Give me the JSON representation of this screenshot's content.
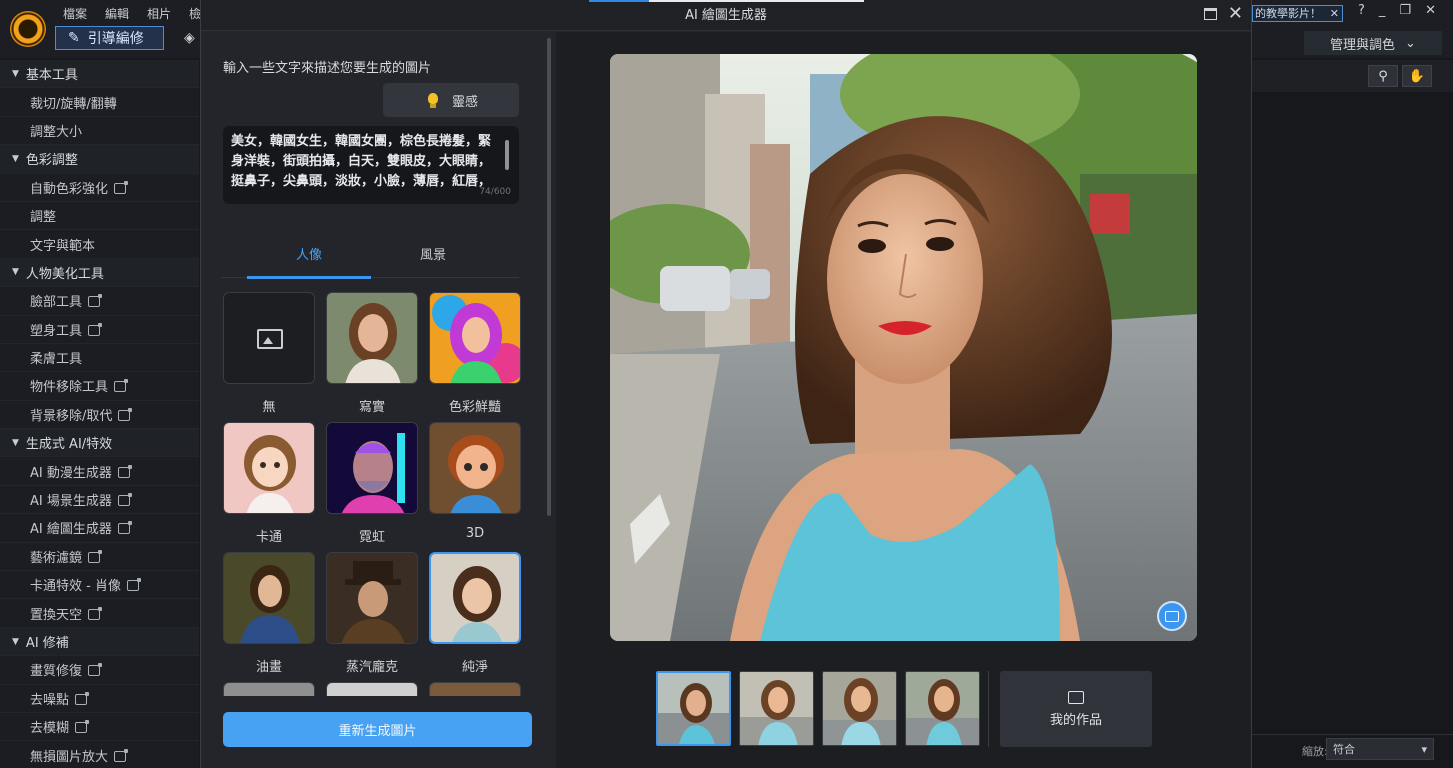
{
  "app": {
    "menu": [
      "檔案",
      "編輯",
      "相片",
      "檢"
    ],
    "guide_label": "引導編修",
    "notice": "的教學影片！",
    "manage_label": "管理與調色",
    "zoom_label": "縮放:",
    "zoom_value": "符合"
  },
  "sidebar": [
    {
      "label": "基本工具",
      "type": "cat"
    },
    {
      "label": "裁切/旋轉/翻轉",
      "type": "item"
    },
    {
      "label": "調整大小",
      "type": "item"
    },
    {
      "label": "色彩調整",
      "type": "cat"
    },
    {
      "label": "自動色彩強化",
      "type": "item",
      "ai": true
    },
    {
      "label": "調整",
      "type": "item"
    },
    {
      "label": "文字與範本",
      "type": "item"
    },
    {
      "label": "人物美化工具",
      "type": "cat"
    },
    {
      "label": "臉部工具",
      "type": "item",
      "ai": true
    },
    {
      "label": "塑身工具",
      "type": "item",
      "ai": true
    },
    {
      "label": "柔膚工具",
      "type": "item"
    },
    {
      "label": "物件移除工具",
      "type": "item",
      "ai": true
    },
    {
      "label": "背景移除/取代",
      "type": "item",
      "ai": true
    },
    {
      "label": "生成式 AI/特效",
      "type": "cat"
    },
    {
      "label": "AI 動漫生成器",
      "type": "item",
      "ai": true
    },
    {
      "label": "AI 場景生成器",
      "type": "item",
      "ai": true
    },
    {
      "label": "AI 繪圖生成器",
      "type": "item",
      "ai": true
    },
    {
      "label": "藝術濾鏡",
      "type": "item",
      "ai": true
    },
    {
      "label": "卡通特效 - 肖像",
      "type": "item",
      "ai": true
    },
    {
      "label": "置換天空",
      "type": "item",
      "ai": true
    },
    {
      "label": "AI 修補",
      "type": "cat"
    },
    {
      "label": "畫質修復",
      "type": "item",
      "ai": true
    },
    {
      "label": "去噪點",
      "type": "item",
      "ai": true
    },
    {
      "label": "去模糊",
      "type": "item",
      "ai": true
    },
    {
      "label": "無損圖片放大",
      "type": "item",
      "ai": true
    }
  ],
  "dialog": {
    "title": "AI 繪圖生成器",
    "prompt_label": "輸入一些文字來描述您要生成的圖片",
    "inspire_label": "靈感",
    "prompt_text": "美女，韓國女生，韓國女團，棕色長捲髮，緊身洋裝，街頭拍攝，白天，雙眼皮，大眼睛，挺鼻子，尖鼻頭，淡妝，小臉，薄唇，紅唇，",
    "prompt_count": "74/600",
    "tabs": [
      "人像",
      "風景"
    ],
    "styles": [
      {
        "label": "無"
      },
      {
        "label": "寫實"
      },
      {
        "label": "色彩鮮豔"
      },
      {
        "label": "卡通"
      },
      {
        "label": "霓虹"
      },
      {
        "label": "3D"
      },
      {
        "label": "油畫"
      },
      {
        "label": "蒸汽龐克"
      },
      {
        "label": "純淨"
      }
    ],
    "regen_label": "重新生成圖片",
    "my_works_label": "我的作品"
  }
}
